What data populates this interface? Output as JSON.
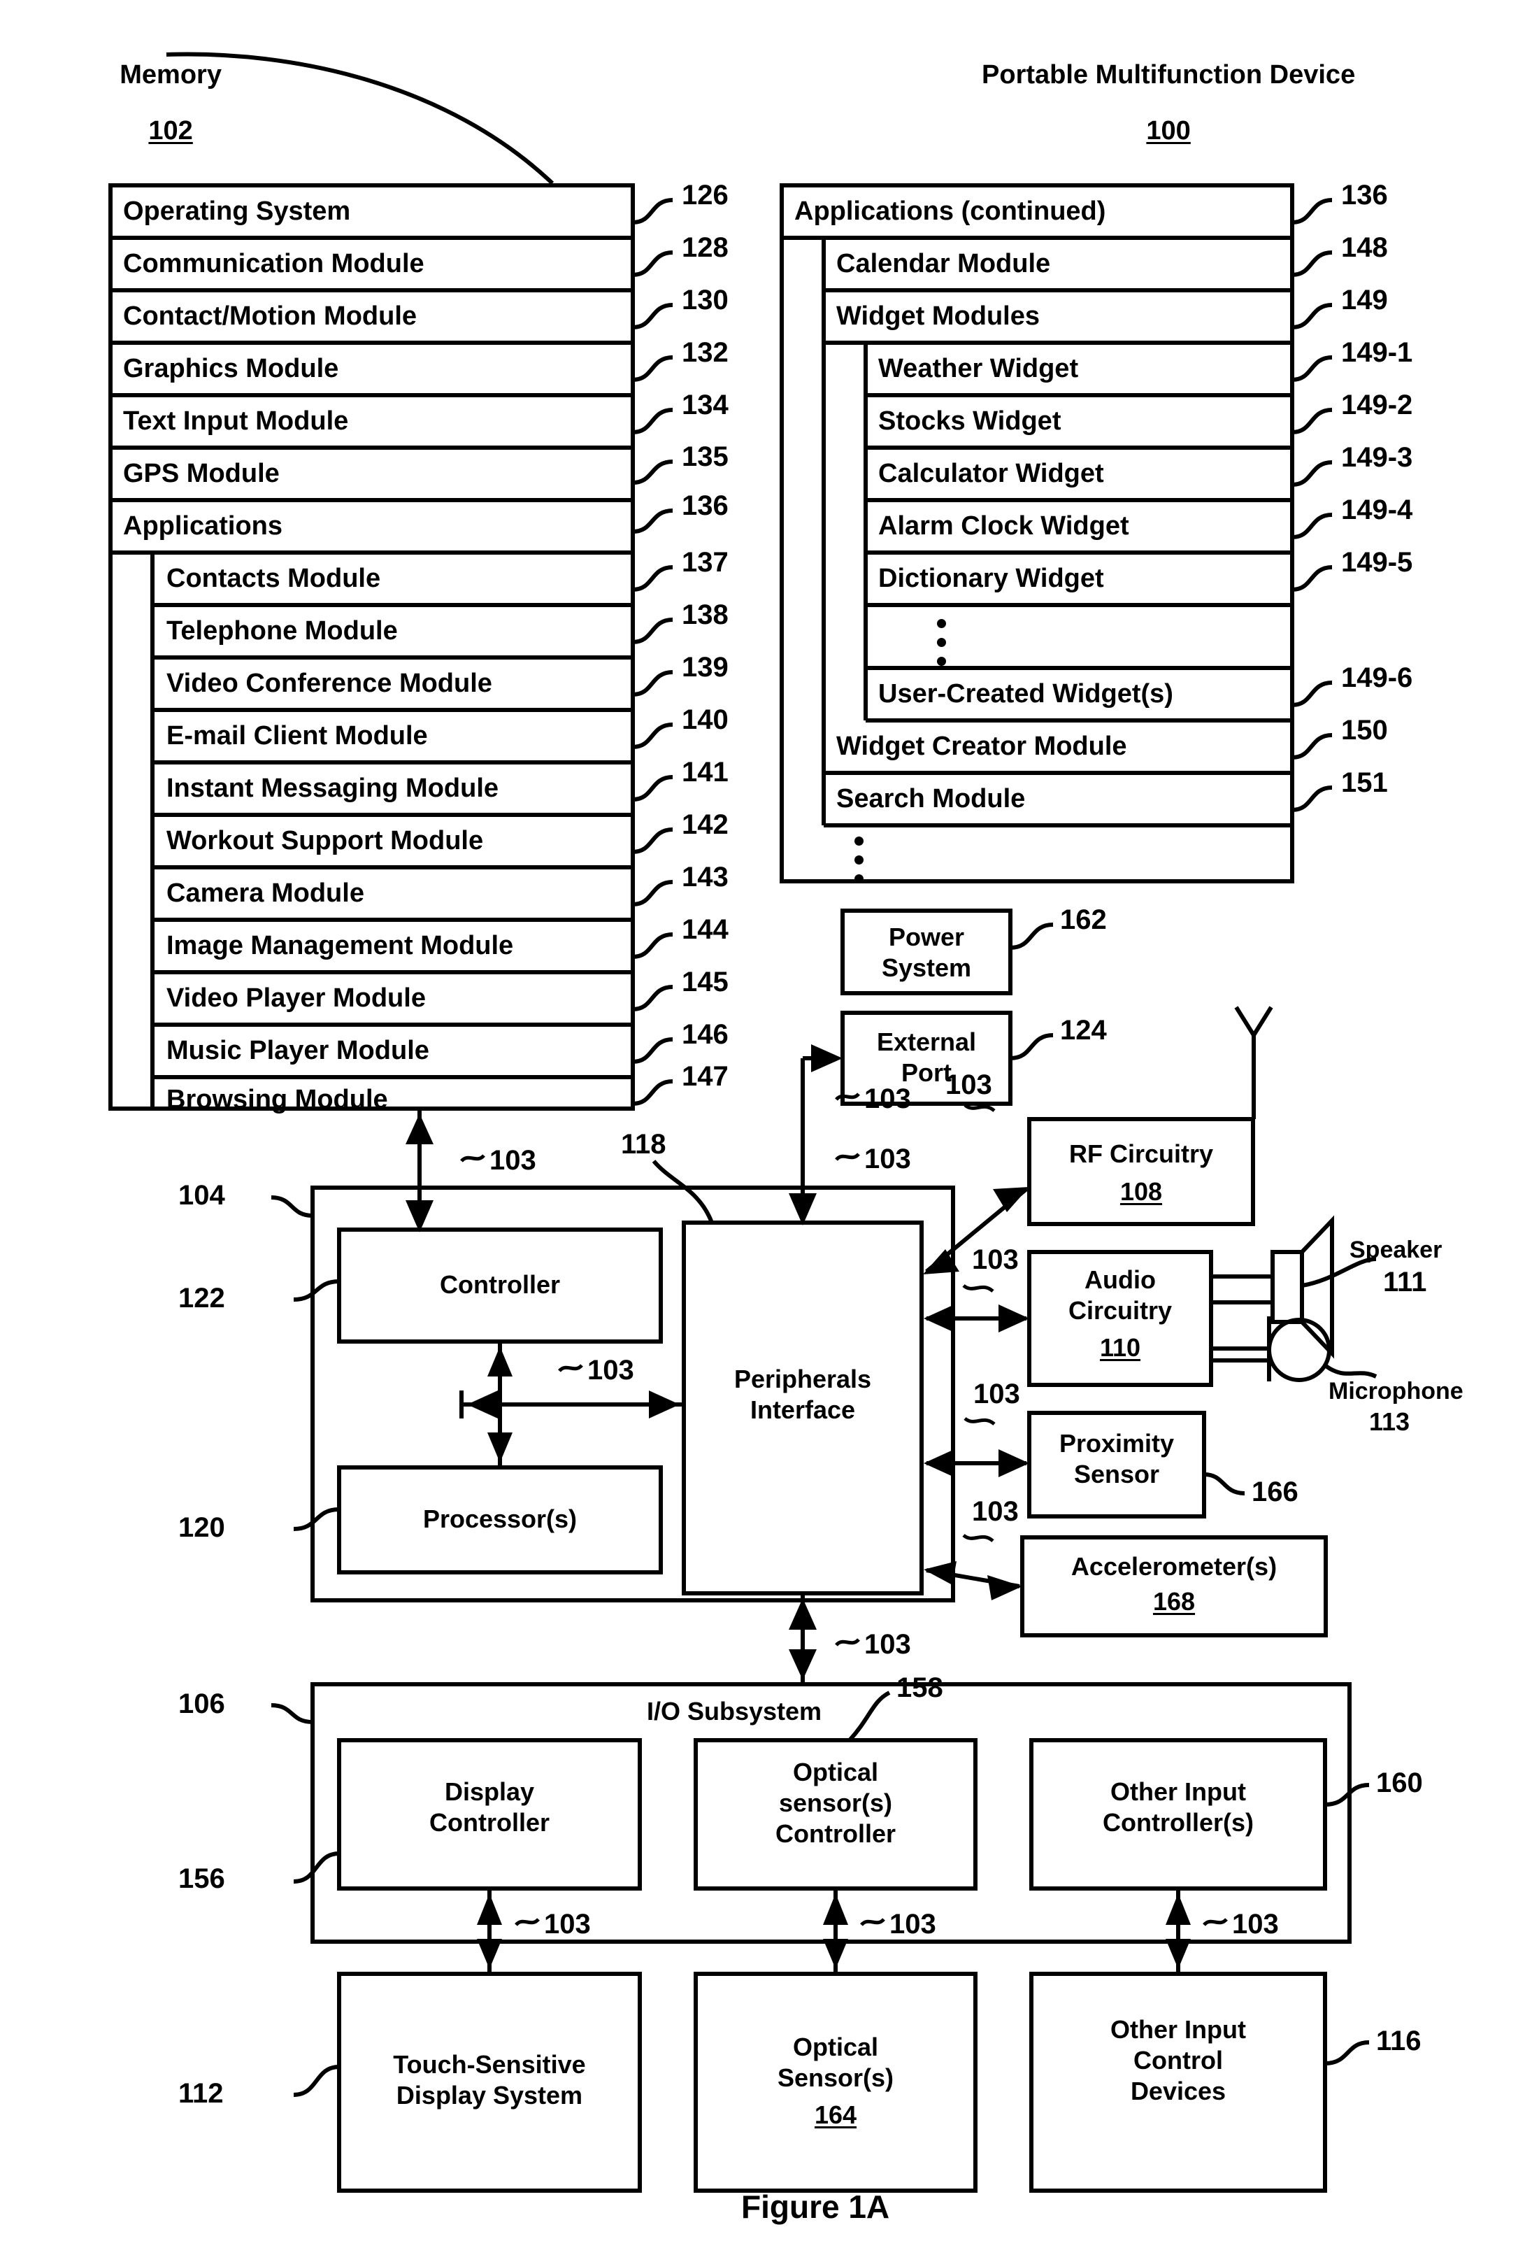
{
  "figure": {
    "caption": "Figure 1A"
  },
  "memory": {
    "title": "Memory",
    "ref": "102",
    "rows": [
      {
        "label": "Operating System",
        "ref": "126",
        "indent": 0
      },
      {
        "label": "Communication Module",
        "ref": "128",
        "indent": 0
      },
      {
        "label": "Contact/Motion Module",
        "ref": "130",
        "indent": 0
      },
      {
        "label": "Graphics Module",
        "ref": "132",
        "indent": 0
      },
      {
        "label": "Text Input Module",
        "ref": "134",
        "indent": 0
      },
      {
        "label": "GPS Module",
        "ref": "135",
        "indent": 0
      },
      {
        "label": "Applications",
        "ref": "136",
        "indent": 0
      },
      {
        "label": "Contacts Module",
        "ref": "137",
        "indent": 1
      },
      {
        "label": "Telephone Module",
        "ref": "138",
        "indent": 1
      },
      {
        "label": "Video Conference Module",
        "ref": "139",
        "indent": 1
      },
      {
        "label": "E-mail Client Module",
        "ref": "140",
        "indent": 1
      },
      {
        "label": "Instant Messaging Module",
        "ref": "141",
        "indent": 1
      },
      {
        "label": "Workout Support Module",
        "ref": "142",
        "indent": 1
      },
      {
        "label": "Camera Module",
        "ref": "143",
        "indent": 1
      },
      {
        "label": "Image Management Module",
        "ref": "144",
        "indent": 1
      },
      {
        "label": "Video Player Module",
        "ref": "145",
        "indent": 1
      },
      {
        "label": "Music Player Module",
        "ref": "146",
        "indent": 1
      },
      {
        "label": "Browsing Module",
        "ref": "147",
        "indent": 1
      }
    ]
  },
  "device": {
    "title": "Portable Multifunction Device",
    "ref": "100",
    "rows": [
      {
        "label": "Applications (continued)",
        "ref": "136",
        "indent": 0
      },
      {
        "label": "Calendar Module",
        "ref": "148",
        "indent": 1
      },
      {
        "label": "Widget Modules",
        "ref": "149",
        "indent": 1
      },
      {
        "label": "Weather Widget",
        "ref": "149-1",
        "indent": 2
      },
      {
        "label": "Stocks Widget",
        "ref": "149-2",
        "indent": 2
      },
      {
        "label": "Calculator Widget",
        "ref": "149-3",
        "indent": 2
      },
      {
        "label": "Alarm Clock Widget",
        "ref": "149-4",
        "indent": 2
      },
      {
        "label": "Dictionary Widget",
        "ref": "149-5",
        "indent": 2
      },
      {
        "label": "",
        "ref": "",
        "indent": 2,
        "ellipsis": true
      },
      {
        "label": "User-Created Widget(s)",
        "ref": "149-6",
        "indent": 2
      },
      {
        "label": "Widget Creator Module",
        "ref": "150",
        "indent": 1
      },
      {
        "label": "Search Module",
        "ref": "151",
        "indent": 1
      }
    ],
    "trailing_ellipsis": true
  },
  "blocks": {
    "power_system": {
      "label": "Power\nSystem",
      "ref": "162"
    },
    "external_port": {
      "label": "External\nPort",
      "ref": "124"
    },
    "rf_circuitry": {
      "label": "RF Circuitry",
      "ref": "108"
    },
    "audio_circuitry": {
      "label": "Audio\nCircuitry",
      "ref": "110"
    },
    "proximity_sensor": {
      "label": "Proximity\nSensor",
      "ref": "166"
    },
    "accelerometers": {
      "label": "Accelerometer(s)",
      "ref": "168"
    },
    "controller": {
      "label": "Controller",
      "ref": "122"
    },
    "processors": {
      "label": "Processor(s)",
      "ref": "120"
    },
    "peripherals_interface": {
      "label": "Peripherals\nInterface",
      "ref": "118"
    },
    "device_outer": {
      "label": "",
      "ref": "104"
    },
    "io_subsystem": {
      "label": "I/O Subsystem",
      "ref": "106"
    },
    "display_controller": {
      "label": "Display\nController",
      "ref": "156"
    },
    "optical_controller": {
      "label": "Optical\nsensor(s)\nController",
      "ref": "158"
    },
    "other_input_controller": {
      "label": "Other Input\nController(s)",
      "ref": "160"
    },
    "touch_display": {
      "label": "Touch-Sensitive\nDisplay System",
      "ref": "112"
    },
    "optical_sensors": {
      "label": "Optical\nSensor(s)",
      "ref": "164"
    },
    "other_input_devices": {
      "label": "Other Input\nControl\nDevices",
      "ref": "116"
    }
  },
  "peripherals": {
    "speaker": {
      "label": "Speaker",
      "ref": "111"
    },
    "microphone": {
      "label": "Microphone",
      "ref": "113"
    }
  },
  "bus_ref": "103",
  "bus_labels": [
    "103",
    "103",
    "103",
    "103",
    "103",
    "103",
    "103",
    "103",
    "103",
    "103",
    "103",
    "103",
    "103"
  ]
}
